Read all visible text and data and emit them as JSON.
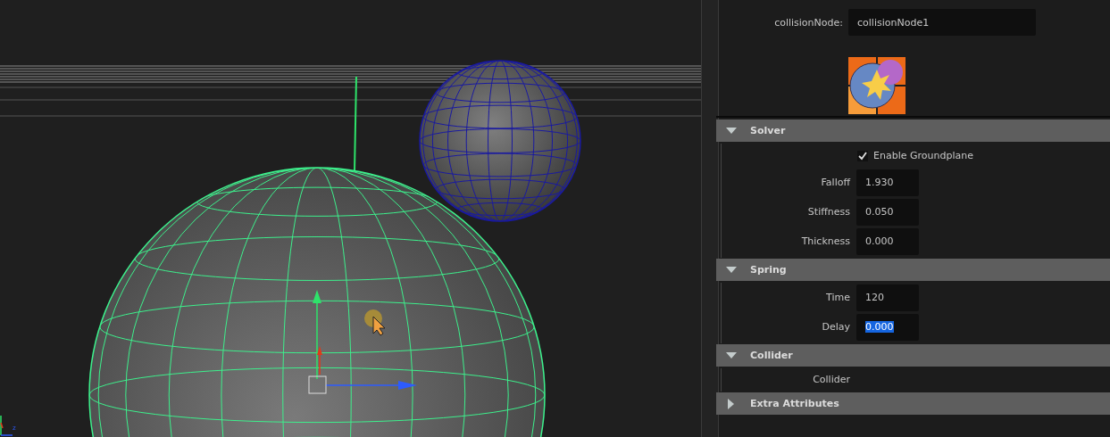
{
  "viewport": {
    "axis_label": "z"
  },
  "node": {
    "label": "collisionNode:",
    "value": "collisionNode1"
  },
  "sections": [
    {
      "title": "Solver",
      "expanded": true,
      "rows": [
        {
          "kind": "checkbox",
          "label": "Enable Groundplane",
          "checked": true
        },
        {
          "kind": "field",
          "label": "Falloff",
          "value": "1.930",
          "selected": false
        },
        {
          "kind": "field",
          "label": "Stiffness",
          "value": "0.050",
          "selected": false
        },
        {
          "kind": "field",
          "label": "Thickness",
          "value": "0.000",
          "selected": false
        }
      ]
    },
    {
      "title": "Spring",
      "expanded": true,
      "rows": [
        {
          "kind": "field",
          "label": "Time",
          "value": "120",
          "selected": false
        },
        {
          "kind": "field",
          "label": "Delay",
          "value": "0.000",
          "selected": true
        }
      ]
    },
    {
      "title": "Collider",
      "expanded": true,
      "rows": [
        {
          "kind": "label",
          "label": "Collider"
        }
      ]
    },
    {
      "title": "Extra Attributes",
      "expanded": false
    }
  ]
}
